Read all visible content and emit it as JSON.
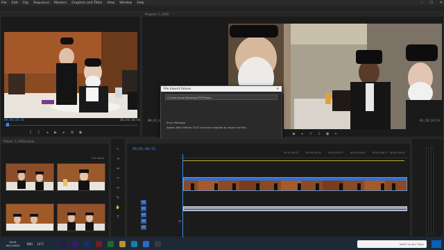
{
  "menu": [
    "File",
    "Edit",
    "Clip",
    "Sequence",
    "Markers",
    "Graphics and Titles",
    "View",
    "Window",
    "Help"
  ],
  "window": {
    "minimize": "–",
    "maximize": "☐",
    "close": "✕"
  },
  "source_monitor": {
    "timecode_left": "00;00;00;00",
    "timecode_right": "00;00;28;44"
  },
  "program_monitor": {
    "title": "Program: 1_0300",
    "timecode_left": "00;41;40;51",
    "timecode_right": "01;29;24;23"
  },
  "dialog": {
    "title": "File Import Failure",
    "close": "✕",
    "path": "C:\\Users\\User\\Desktop\\TOPP.aepx",
    "error_label": "Error Message",
    "error_message": "Adobe After Effects 2023 must be installed to import the file.",
    "ok_label": "OK"
  },
  "project_panel": {
    "title": "Project: 1_0300.prproj",
    "item_count": "134 Items"
  },
  "timeline": {
    "timecode": "00;01;40;51",
    "ruler_labels": [
      "00;41;42;17",
      "00;41;43;01",
      "00;41;43;17",
      "00;41;44;01",
      "00;41;44;17",
      "00;41;45;01"
    ],
    "track_labels": [
      "V1",
      "V2",
      "A1",
      "A2",
      "A3"
    ]
  },
  "taskbar": {
    "time": "16:45",
    "date": "16/11/2022",
    "search_text": "הקלד כאן כדי לחפש",
    "lang": "ENG",
    "temp": "12°C"
  },
  "colors": {
    "accent_blue": "#2f6ed8",
    "timecode_blue": "#3b8ce6",
    "clip_blue": "#2b5aa8",
    "audio_clip": "#9aa6b8",
    "playhead": "#3b8ce6"
  }
}
